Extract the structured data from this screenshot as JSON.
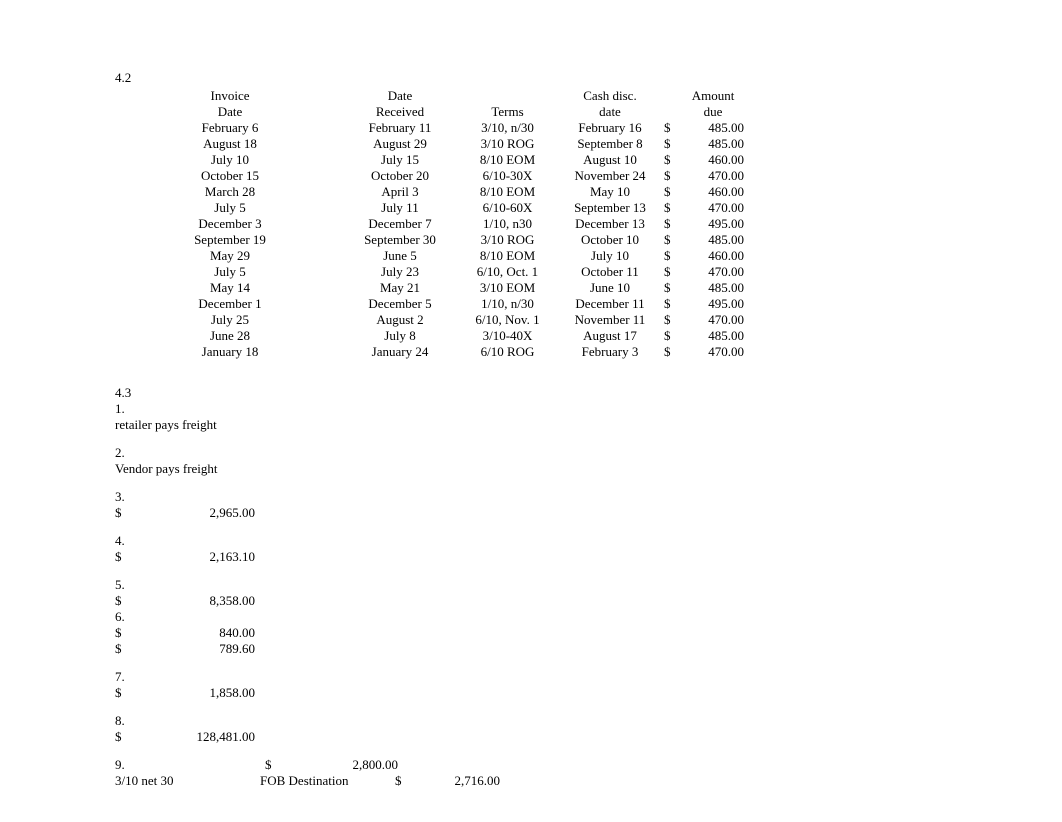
{
  "section42": {
    "label": "4.2",
    "headers": {
      "invoice_l1": "Invoice",
      "invoice_l2": "Date",
      "received_l1": "Date",
      "received_l2": "Received",
      "terms": "Terms",
      "cashdisc_l1": "Cash disc.",
      "cashdisc_l2": "date",
      "amount_l1": "Amount",
      "amount_l2": "due"
    },
    "rows": [
      {
        "invoice": "February 6",
        "received": "February 11",
        "terms": "3/10, n/30",
        "cashdisc": "February 16",
        "cur": "$",
        "amount": "485.00"
      },
      {
        "invoice": "August 18",
        "received": "August 29",
        "terms": "3/10 ROG",
        "cashdisc": "September 8",
        "cur": "$",
        "amount": "485.00"
      },
      {
        "invoice": "July 10",
        "received": "July 15",
        "terms": "8/10 EOM",
        "cashdisc": "August 10",
        "cur": "$",
        "amount": "460.00"
      },
      {
        "invoice": "October 15",
        "received": "October 20",
        "terms": "6/10-30X",
        "cashdisc": "November 24",
        "cur": "$",
        "amount": "470.00"
      },
      {
        "invoice": "March 28",
        "received": "April 3",
        "terms": "8/10 EOM",
        "cashdisc": "May 10",
        "cur": "$",
        "amount": "460.00"
      },
      {
        "invoice": "July 5",
        "received": "July 11",
        "terms": "6/10-60X",
        "cashdisc": "September 13",
        "cur": "$",
        "amount": "470.00"
      },
      {
        "invoice": "December 3",
        "received": "December 7",
        "terms": "1/10, n30",
        "cashdisc": "December 13",
        "cur": "$",
        "amount": "495.00"
      },
      {
        "invoice": "September 19",
        "received": "September 30",
        "terms": "3/10 ROG",
        "cashdisc": "October 10",
        "cur": "$",
        "amount": "485.00"
      },
      {
        "invoice": "May 29",
        "received": "June 5",
        "terms": "8/10 EOM",
        "cashdisc": "July 10",
        "cur": "$",
        "amount": "460.00"
      },
      {
        "invoice": "July 5",
        "received": "July 23",
        "terms": "6/10, Oct. 1",
        "cashdisc": "October 11",
        "cur": "$",
        "amount": "470.00"
      },
      {
        "invoice": "May 14",
        "received": "May 21",
        "terms": "3/10 EOM",
        "cashdisc": "June 10",
        "cur": "$",
        "amount": "485.00"
      },
      {
        "invoice": "December 1",
        "received": "December 5",
        "terms": "1/10, n/30",
        "cashdisc": "December 11",
        "cur": "$",
        "amount": "495.00"
      },
      {
        "invoice": "July 25",
        "received": "August 2",
        "terms": "6/10, Nov. 1",
        "cashdisc": "November 11",
        "cur": "$",
        "amount": "470.00"
      },
      {
        "invoice": "June 28",
        "received": "July 8",
        "terms": "3/10-40X",
        "cashdisc": "August 17",
        "cur": "$",
        "amount": "485.00"
      },
      {
        "invoice": "January 18",
        "received": "January 24",
        "terms": "6/10 ROG",
        "cashdisc": "February 3",
        "cur": "$",
        "amount": "470.00"
      }
    ]
  },
  "section43": {
    "label": "4.3",
    "q1": {
      "num": "1.",
      "text": "retailer pays freight"
    },
    "q2": {
      "num": "2.",
      "text": "Vendor pays freight"
    },
    "q3": {
      "num": "3.",
      "cur": "$",
      "amount": "2,965.00"
    },
    "q4": {
      "num": "4.",
      "cur": "$",
      "amount": "2,163.10"
    },
    "q5": {
      "num": "5.",
      "cur": "$",
      "amount": "8,358.00"
    },
    "q6": {
      "num": "6.",
      "line1": {
        "cur": "$",
        "amount": "840.00"
      },
      "line2": {
        "cur": "$",
        "amount": "789.60"
      }
    },
    "q7": {
      "num": "7.",
      "cur": "$",
      "amount": "1,858.00"
    },
    "q8": {
      "num": "8.",
      "cur": "$",
      "amount": "128,481.00"
    },
    "q9": {
      "num": "9.",
      "line1": {
        "cur": "$",
        "amount": "2,800.00"
      },
      "line2": {
        "terms": "3/10 net 30",
        "fob": "FOB Destination",
        "cur": "$",
        "amount": "2,716.00"
      }
    }
  }
}
